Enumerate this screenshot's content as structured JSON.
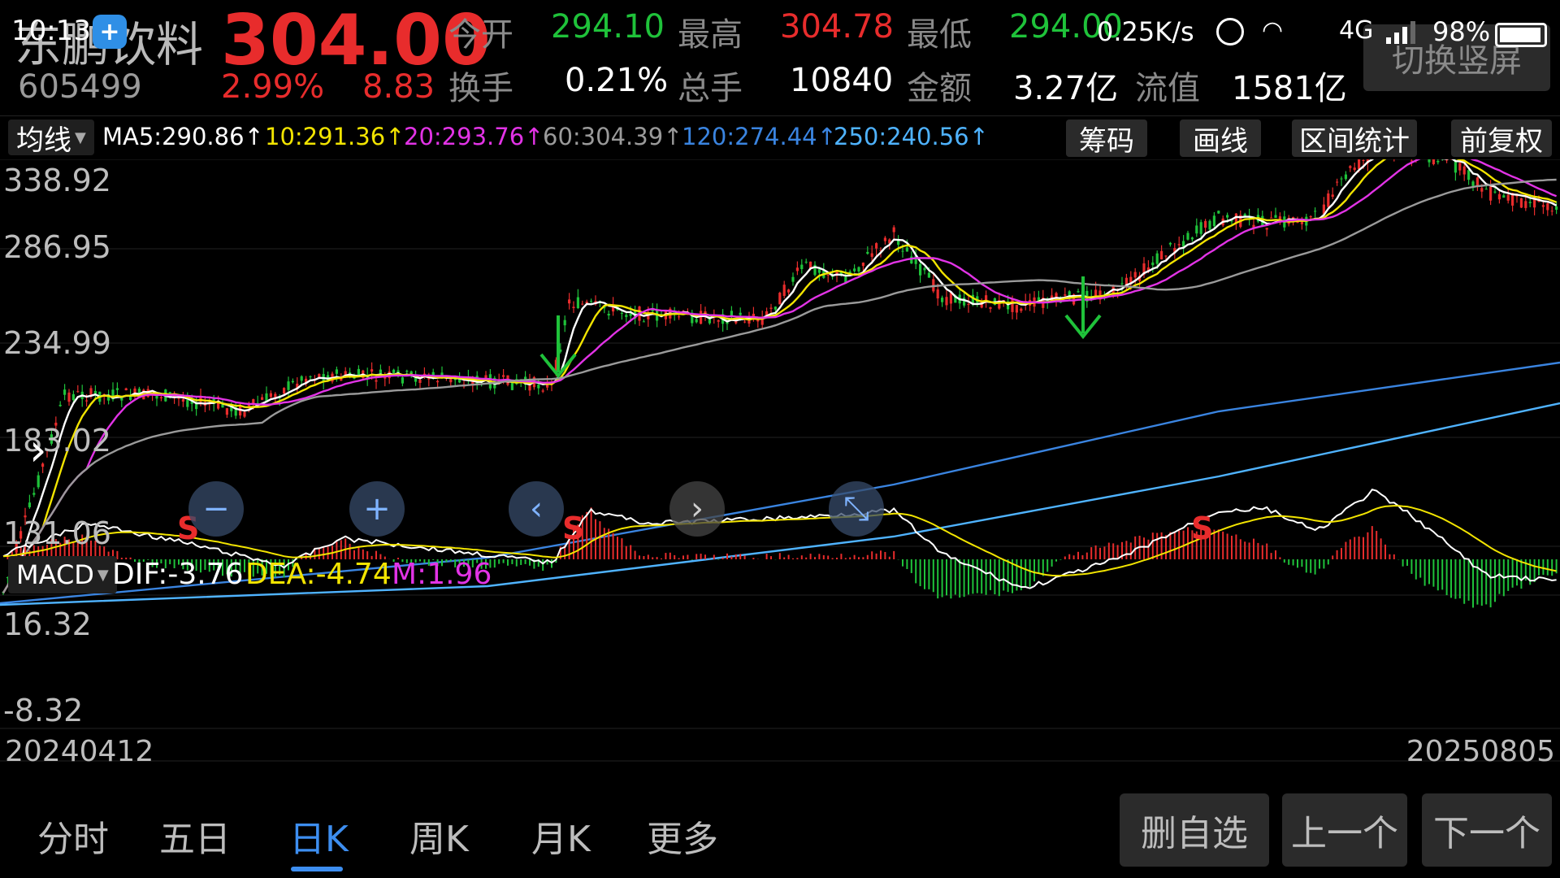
{
  "status_bar": {
    "time": "10:13",
    "network_speed": "0.25K/s",
    "network_type": "4G",
    "battery": "98%"
  },
  "quote": {
    "name": "东鹏饮料",
    "code": "605499",
    "price": "304.00",
    "change_pct": "2.99%",
    "change": "8.83",
    "open_label": "今开",
    "open": "294.10",
    "high_label": "最高",
    "high": "304.78",
    "low_label": "最低",
    "low": "294.00",
    "turnover_label": "换手",
    "turnover": "0.21%",
    "volume_label": "总手",
    "volume": "10840",
    "amount_label": "金额",
    "amount": "3.27亿",
    "float_label": "流值",
    "float_value": "1581亿",
    "switch_label": "切换竖屏"
  },
  "ma_bar": {
    "indicator": "均线",
    "ma5": "MA5:290.86↑",
    "ma10": "10:291.36↑",
    "ma20": "20:293.76↑",
    "ma60": "60:304.39↑",
    "ma120": "120:274.44↑",
    "ma250": "250:240.56↑",
    "colors": {
      "ma5": "#ffffff",
      "ma10": "#f2e400",
      "ma20": "#e233e6",
      "ma60": "#9a9a9a",
      "ma120": "#3a84e0",
      "ma250": "#4fb3ff"
    },
    "tools": {
      "chips": "筹码",
      "draw": "画线",
      "range_stats": "区间统计",
      "adjust": "前复权"
    }
  },
  "price_axis": {
    "l1": "338.92",
    "l2": "286.95",
    "l3": "234.99",
    "l4": "183.02",
    "l5": "131.06"
  },
  "macd": {
    "indicator": "MACD",
    "dif": "DIF:-3.76",
    "dea": "DEA:-4.74",
    "m": "M:1.96",
    "axis_top": "16.32",
    "axis_bottom": "-8.32"
  },
  "dates": {
    "start": "20240412",
    "end": "20250805"
  },
  "signals": {
    "s": "S"
  },
  "tabs": {
    "t1": "分时",
    "t2": "五日",
    "t3": "日K",
    "t4": "周K",
    "t5": "月K",
    "t6": "更多"
  },
  "actions": {
    "remove": "删自选",
    "prev": "上一个",
    "next": "下一个"
  },
  "accent_up": "#e82c2c",
  "accent_down": "#1fc23a",
  "accent_active": "#3d8ef0"
}
